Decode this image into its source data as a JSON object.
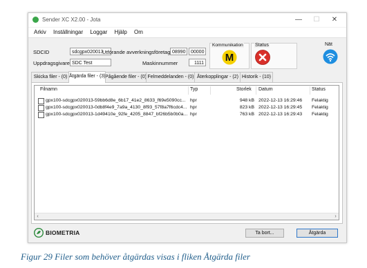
{
  "window": {
    "title": "Sender XC X2.00 - Jota",
    "controls": {
      "minimize": "—",
      "maximize": "☐",
      "close": "✕"
    }
  },
  "menu": [
    "Arkiv",
    "Inställningar",
    "Loggar",
    "Hjälp",
    "Om"
  ],
  "form": {
    "sdcid_label": "SDCID",
    "sdcid_value": "sdcgpx020013",
    "uppdragsgivare_label": "Uppdragsgivare",
    "uppdragsgivare_value": "SDC Test",
    "utforande_label": "Utförande avverkningsföretag",
    "utforande_value1": "08990",
    "utforande_value2": "00000",
    "maskinnummer_label": "Maskinnummer",
    "maskinnummer_value": "1111"
  },
  "status_panels": {
    "kommunikation": {
      "label": "Kommunikation",
      "letter": "M",
      "color": "#f5d000"
    },
    "status": {
      "label": "Status",
      "color": "#d9302a"
    },
    "nat": {
      "label": "Nät",
      "color": "#1e8ee0"
    }
  },
  "tabs": [
    "Skicka filer - (0)",
    "Åtgärda filer - (3)",
    "Pågående filer - (0)",
    "Felmeddelanden - (0)",
    "Återkopplingar - (2)",
    "Historik - (10)"
  ],
  "active_tab": 1,
  "table": {
    "headers": [
      "Filnamn",
      "Typ",
      "Storlek",
      "Datum",
      "Status"
    ],
    "rows": [
      {
        "name": "gpx100-sdcgpx020013-59bb6d8e_6b17_41e2_8633_f69e5090cc...",
        "type": "hpr",
        "size": "948 kB",
        "date": "2022-12-13 16:29:46",
        "status": "Felaktig"
      },
      {
        "name": "gpx100-sdcgpx020013-0db8f4e9_7a9a_4130_8f93_57f8a7f6cdc4...",
        "type": "hpr",
        "size": "823 kB",
        "date": "2022-12-13 16:29:45",
        "status": "Felaktig"
      },
      {
        "name": "gpx100-sdcgpx020013-1d49410e_92fe_4205_8847_bf26b5b0b0a...",
        "type": "hpr",
        "size": "763 kB",
        "date": "2022-12-13 16:29:43",
        "status": "Felaktig"
      }
    ]
  },
  "buttons": {
    "ta_bort": "Ta bort...",
    "atgarda": "Åtgärda"
  },
  "logo_text": "BIOMETRIA",
  "caption": "Figur 29 Filer som behöver åtgärdas visas i fliken Åtgärda filer"
}
